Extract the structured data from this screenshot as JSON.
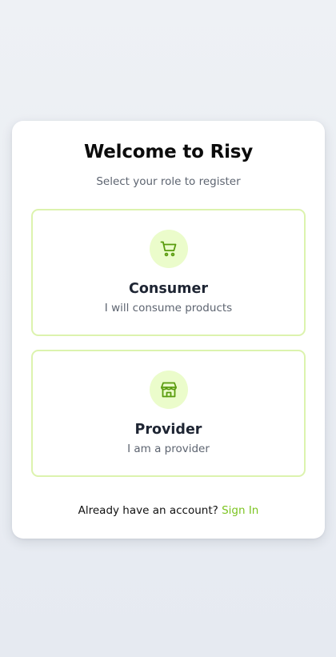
{
  "header": {
    "title": "Welcome to Risy",
    "subtitle": "Select your role to register"
  },
  "roles": [
    {
      "icon": "shopping-cart-icon",
      "title": "Consumer",
      "description": "I will consume products"
    },
    {
      "icon": "store-icon",
      "title": "Provider",
      "description": "I am a provider"
    }
  ],
  "footer": {
    "prompt": "Already have an account?",
    "link_label": "Sign In"
  },
  "colors": {
    "accent": "#7cc420",
    "icon_stroke": "#5a9c0e",
    "icon_background": "#ebfccb",
    "option_border": "#dcf3ae"
  }
}
